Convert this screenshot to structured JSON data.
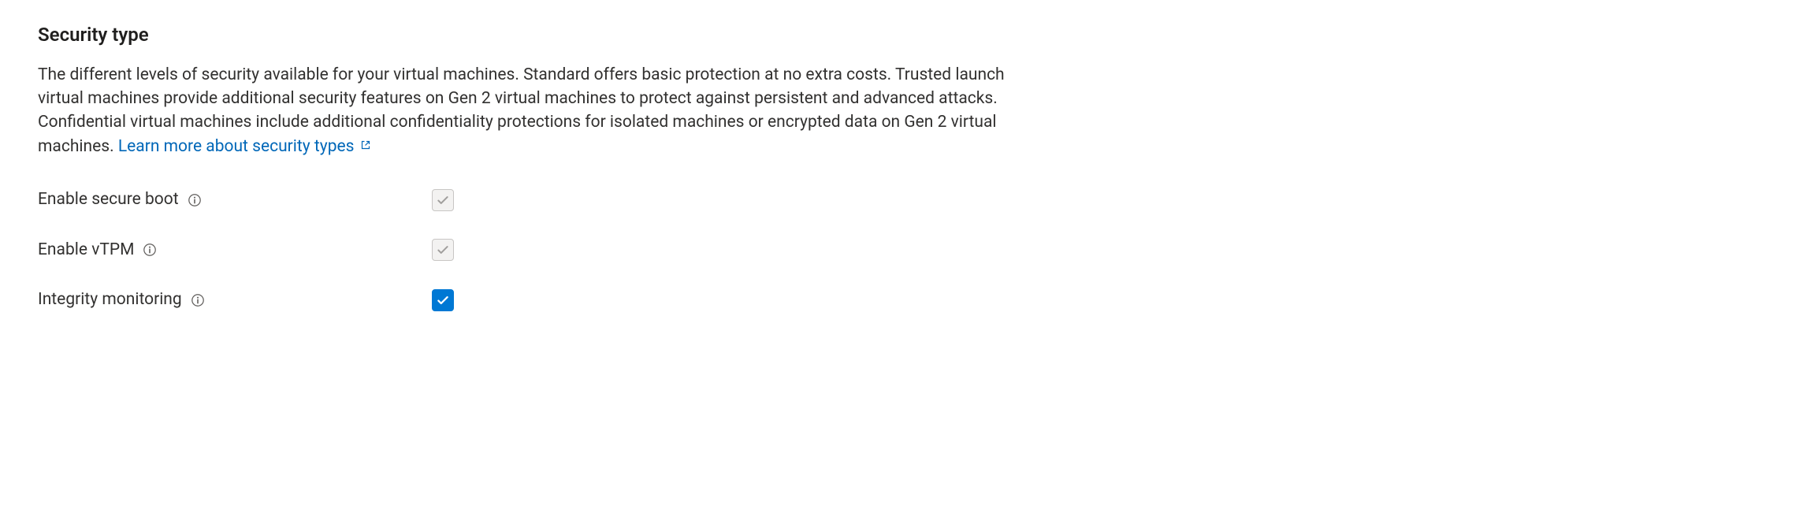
{
  "section": {
    "title": "Security type",
    "description": "The different levels of security available for your virtual machines. Standard offers basic protection at no extra costs. Trusted launch virtual machines provide additional security features on Gen 2 virtual machines to protect against persistent and advanced attacks. Confidential virtual machines include additional confidentiality protections for isolated machines or encrypted data on Gen 2 virtual machines.",
    "link_label": "Learn more about security types"
  },
  "options": {
    "secure_boot": {
      "label": "Enable secure boot",
      "checked": true,
      "enabled": false
    },
    "vtpm": {
      "label": "Enable vTPM",
      "checked": true,
      "enabled": false
    },
    "integrity": {
      "label": "Integrity monitoring",
      "checked": true,
      "enabled": true
    }
  }
}
